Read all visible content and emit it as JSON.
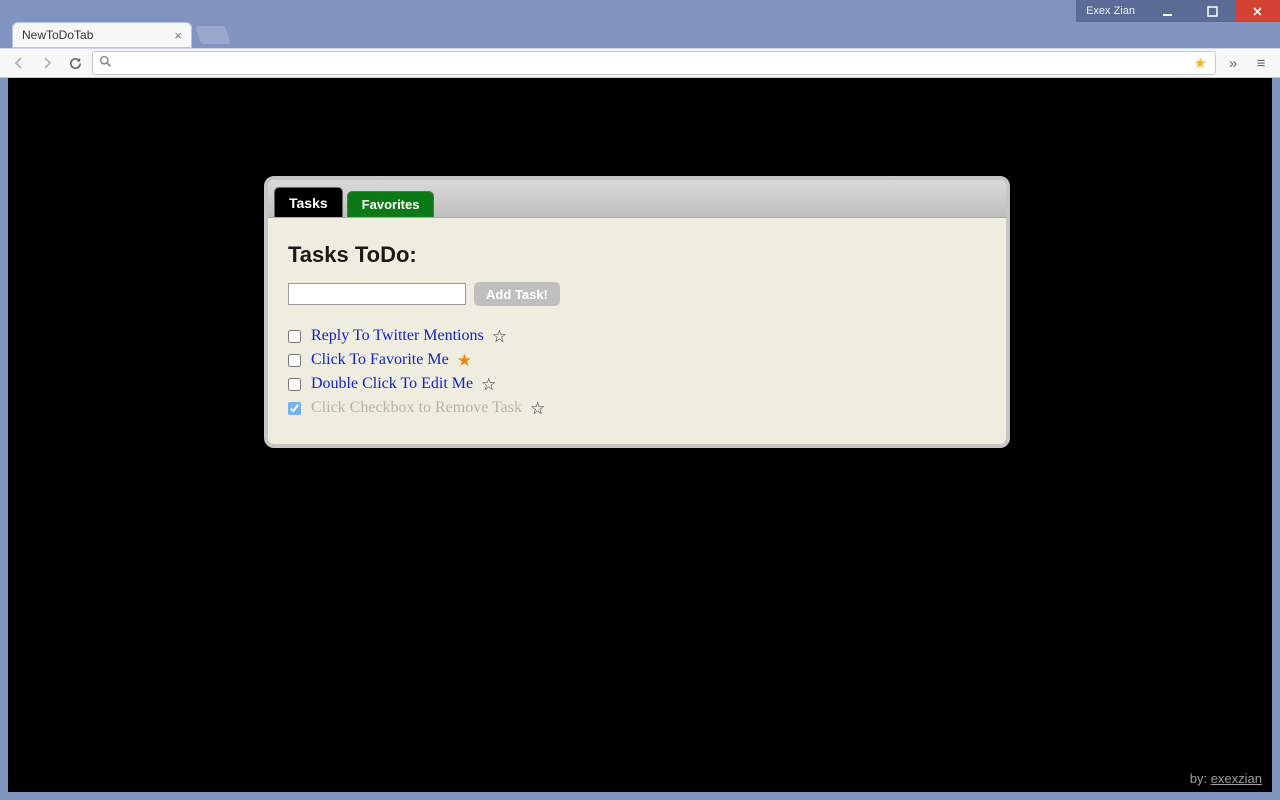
{
  "window": {
    "profile_name": "Exex Zian"
  },
  "browser": {
    "tab_title": "NewToDoTab",
    "omnibox_value": ""
  },
  "app": {
    "tabs": {
      "tasks_label": "Tasks",
      "favorites_label": "Favorites"
    },
    "heading": "Tasks ToDo:",
    "add_button_label": "Add Task!",
    "new_task_value": "",
    "tasks": [
      {
        "label": "Reply To Twitter Mentions",
        "checked": false,
        "favorite": false,
        "faded": false
      },
      {
        "label": "Click To Favorite Me",
        "checked": false,
        "favorite": true,
        "faded": false
      },
      {
        "label": "Double Click To Edit Me",
        "checked": false,
        "favorite": false,
        "faded": false
      },
      {
        "label": "Click Checkbox to Remove Task",
        "checked": true,
        "favorite": false,
        "faded": true
      }
    ],
    "credit_prefix": "by: ",
    "credit_name": "exexzian"
  }
}
